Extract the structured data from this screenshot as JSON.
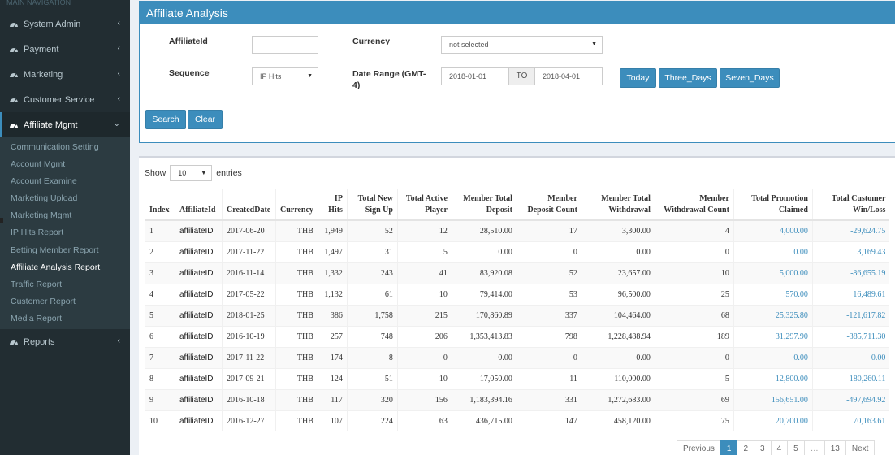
{
  "sidebar": {
    "header": "MAIN NAVIGATION",
    "menu": [
      {
        "label": "System Admin",
        "icon": "dashboard-icon"
      },
      {
        "label": "Payment",
        "icon": "dashboard-icon"
      },
      {
        "label": "Marketing",
        "icon": "dashboard-icon"
      },
      {
        "label": "Customer Service",
        "icon": "dashboard-icon"
      },
      {
        "label": "Affiliate Mgmt",
        "icon": "dashboard-icon"
      }
    ],
    "submenu": [
      "Communication Setting",
      "Account Mgmt",
      "Account Examine",
      "Marketing Upload",
      "Marketing Mgmt",
      "IP Hits Report",
      "Betting Member Report",
      "Affiliate Analysis Report",
      "Traffic Report",
      "Customer Report",
      "Media Report"
    ],
    "reports_label": "Reports"
  },
  "filter": {
    "title": "Affiliate Analysis",
    "affiliate_label": "AffiliateId",
    "affiliate_value": "",
    "currency_label": "Currency",
    "currency_value": "not selected",
    "sequence_label": "Sequence",
    "sequence_value": "IP Hits",
    "date_label": "Date Range (GMT-4)",
    "date_from": "2018-01-01",
    "date_to_label": "TO",
    "date_to": "2018-04-01",
    "today_btn": "Today",
    "three_btn": "Three_Days",
    "seven_btn": "Seven_Days",
    "search_btn": "Search",
    "clear_btn": "Clear"
  },
  "table": {
    "show_label": "Show",
    "entries_value": "10",
    "entries_label": "entries",
    "headers": [
      "Index",
      "AffiliateId",
      "CreatedDate",
      "Currency",
      "IP Hits",
      "Total New Sign Up",
      "Total Active Player",
      "Member Total Deposit",
      "Member Deposit Count",
      "Member Total Withdrawal",
      "Member Withdrawal Count",
      "Total Promotion Claimed",
      "Total Customer Win/Loss"
    ],
    "rows": [
      [
        "1",
        "affiliateID",
        "2017-06-20",
        "THB",
        "1,949",
        "52",
        "12",
        "28,510.00",
        "17",
        "3,300.00",
        "4",
        "4,000.00",
        "-29,624.75"
      ],
      [
        "2",
        "affiliateID",
        "2017-11-22",
        "THB",
        "1,497",
        "31",
        "5",
        "0.00",
        "0",
        "0.00",
        "0",
        "0.00",
        "3,169.43"
      ],
      [
        "3",
        "affiliateID",
        "2016-11-14",
        "THB",
        "1,332",
        "243",
        "41",
        "83,920.08",
        "52",
        "23,657.00",
        "10",
        "5,000.00",
        "-86,655.19"
      ],
      [
        "4",
        "affiliateID",
        "2017-05-22",
        "THB",
        "1,132",
        "61",
        "10",
        "79,414.00",
        "53",
        "96,500.00",
        "25",
        "570.00",
        "16,489.61"
      ],
      [
        "5",
        "affiliateID",
        "2018-01-25",
        "THB",
        "386",
        "1,758",
        "215",
        "170,860.89",
        "337",
        "104,464.00",
        "68",
        "25,325.80",
        "-121,617.82"
      ],
      [
        "6",
        "affiliateID",
        "2016-10-19",
        "THB",
        "257",
        "748",
        "206",
        "1,353,413.83",
        "798",
        "1,228,488.94",
        "189",
        "31,297.90",
        "-385,711.30"
      ],
      [
        "7",
        "affiliateID",
        "2017-11-22",
        "THB",
        "174",
        "8",
        "0",
        "0.00",
        "0",
        "0.00",
        "0",
        "0.00",
        "0.00"
      ],
      [
        "8",
        "affiliateID",
        "2017-09-21",
        "THB",
        "124",
        "51",
        "10",
        "17,050.00",
        "11",
        "110,000.00",
        "5",
        "12,800.00",
        "180,260.11"
      ],
      [
        "9",
        "affiliateID",
        "2016-10-18",
        "THB",
        "117",
        "320",
        "156",
        "1,183,394.16",
        "331",
        "1,272,683.00",
        "69",
        "156,651.00",
        "-497,694.92"
      ],
      [
        "10",
        "affiliateID",
        "2016-12-27",
        "THB",
        "107",
        "224",
        "63",
        "436,715.00",
        "147",
        "458,120.00",
        "75",
        "20,700.00",
        "70,163.61"
      ]
    ]
  },
  "pager": {
    "prev": "Previous",
    "pages": [
      "1",
      "2",
      "3",
      "4",
      "5",
      "…",
      "13"
    ],
    "next": "Next"
  },
  "colors": {
    "accent": "#3c8dbc",
    "sidebar": "#222d32"
  }
}
